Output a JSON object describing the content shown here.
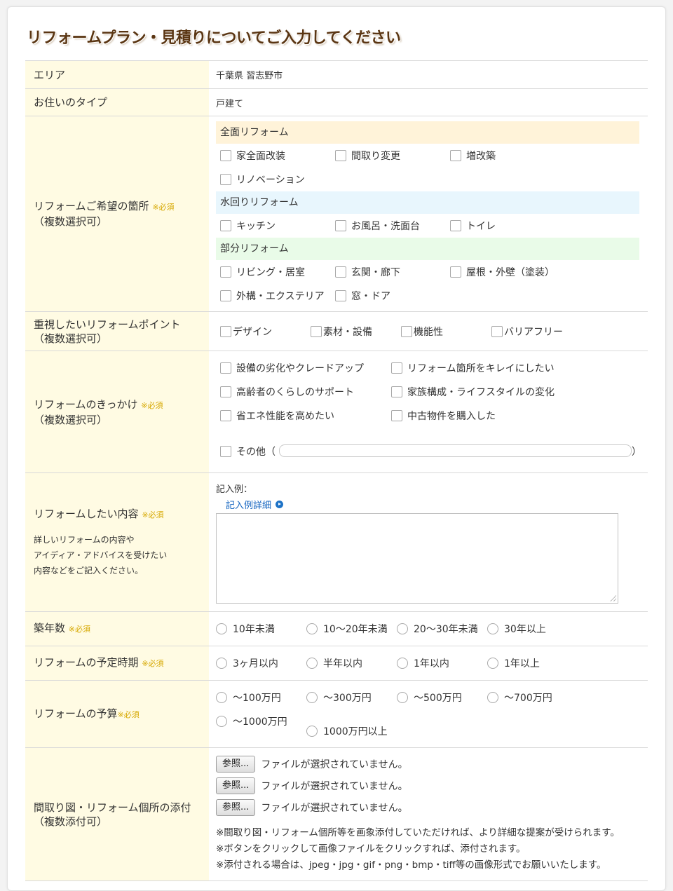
{
  "page": {
    "title": "リフォームプラン・見積りについてご入力してください"
  },
  "area": {
    "label": "エリア",
    "value": "千葉県 習志野市"
  },
  "housing": {
    "label": "お住いのタイプ",
    "value": "戸建て"
  },
  "locations": {
    "label": "リフォームご希望の箇所",
    "required": "※必須",
    "sub": "（複数選択可）",
    "full": {
      "heading": "全面リフォーム",
      "options": [
        "家全面改装",
        "間取り変更",
        "増改築",
        "リノベーション"
      ]
    },
    "water": {
      "heading": "水回りリフォーム",
      "options": [
        "キッチン",
        "お風呂・洗面台",
        "トイレ"
      ]
    },
    "partial": {
      "heading": "部分リフォーム",
      "options": [
        "リビング・居室",
        "玄関・廊下",
        "屋根・外壁（塗装）",
        "外構・エクステリア",
        "窓・ドア"
      ]
    }
  },
  "points": {
    "label": "重視したいリフォームポイント",
    "sub": "（複数選択可）",
    "options": [
      "デザイン",
      "素材・設備",
      "機能性",
      "バリアフリー"
    ]
  },
  "trigger": {
    "label": "リフォームのきっかけ",
    "required": "※必須",
    "sub": "（複数選択可）",
    "options": [
      "設備の劣化やクレードアップ",
      "リフォーム箇所をキレイにしたい",
      "高齢者のくらしのサポート",
      "家族構成・ライフスタイルの変化",
      "省エネ性能を高めたい",
      "中古物件を購入した"
    ],
    "other_label": "その他（",
    "other_close": "）"
  },
  "content": {
    "label": "リフォームしたい内容",
    "required": "※必須",
    "note1": "詳しいリフォームの内容や",
    "note2": "アイディア・アドバイスを受けたい",
    "note3": "内容などをご記入ください。",
    "example_label": "記入例：",
    "example_link": "記入例詳細"
  },
  "age": {
    "label": "築年数",
    "required": "※必須",
    "options": [
      "10年未満",
      "10〜20年未満",
      "20〜30年未満",
      "30年以上"
    ]
  },
  "schedule": {
    "label": "リフォームの予定時期",
    "required": "※必須",
    "options": [
      "3ヶ月以内",
      "半年以内",
      "1年以内",
      "1年以上"
    ]
  },
  "budget": {
    "label": "リフォームの予算",
    "required": "※必須",
    "options": [
      "〜100万円",
      "〜300万円",
      "〜500万円",
      "〜700万円",
      "〜1000万円",
      "1000万円以上"
    ]
  },
  "attachment": {
    "label": "間取り図・リフォーム個所の添付",
    "sub": "（複数添付可）",
    "browse_label": "参照...",
    "no_file": "ファイルが選択されていません。",
    "note1": "※間取り図・リフォーム個所等を画象添付していただければ、より詳細な提案が受けられます。",
    "note2": "※ボタンをクリックして画像ファイルをクリックすれば、添付されます。",
    "note3": "※添付される場合は、jpeg・jpg・gif・png・bmp・tiff等の画像形式でお願いいたします。"
  }
}
